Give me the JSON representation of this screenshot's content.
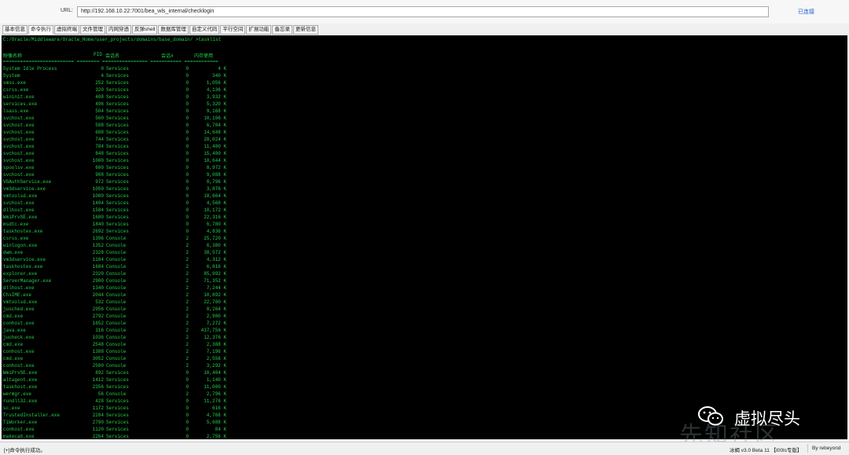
{
  "url_bar": {
    "label": "URL:",
    "value": "http://192.168.10.22:7001/bea_wls_internal/checklogin",
    "status": "已连接"
  },
  "tabs": [
    "基本信息",
    "命令执行",
    "虚拟终端",
    "文件管理",
    "内网穿透",
    "反弹shell",
    "数据库管理",
    "自定义代码",
    "平行空间",
    "扩展功能",
    "备忘录",
    "更新信息"
  ],
  "active_tab": 1,
  "terminal": {
    "prompt": "C:/Oracle/Middleware/Oracle_Home/user_projects/domains/base_domain/ >tasklist",
    "headers": {
      "name": "映像名称",
      "pid": "PID",
      "session_name": "会话名",
      "session_num": "会话#",
      "mem": "内存使用"
    },
    "separator": "========================= ======== ================ =========== ============",
    "processes": [
      [
        "System Idle Process",
        "0",
        "Services",
        "0",
        "4 K"
      ],
      [
        "System",
        "4",
        "Services",
        "0",
        "340 K"
      ],
      [
        "smss.exe",
        "252",
        "Services",
        "0",
        "1,056 K"
      ],
      [
        "csrss.exe",
        "320",
        "Services",
        "0",
        "4,136 K"
      ],
      [
        "wininit.exe",
        "408",
        "Services",
        "0",
        "3,932 K"
      ],
      [
        "services.exe",
        "496",
        "Services",
        "0",
        "5,320 K"
      ],
      [
        "lsass.exe",
        "504",
        "Services",
        "0",
        "9,168 K"
      ],
      [
        "svchost.exe",
        "560",
        "Services",
        "0",
        "10,196 K"
      ],
      [
        "svchost.exe",
        "588",
        "Services",
        "0",
        "6,704 K"
      ],
      [
        "svchost.exe",
        "688",
        "Services",
        "0",
        "14,648 K"
      ],
      [
        "svchost.exe",
        "744",
        "Services",
        "0",
        "28,024 K"
      ],
      [
        "svchost.exe",
        "784",
        "Services",
        "0",
        "11,400 K"
      ],
      [
        "svchost.exe",
        "848",
        "Services",
        "0",
        "15,400 K"
      ],
      [
        "svchost.exe",
        "1000",
        "Services",
        "0",
        "10,644 K"
      ],
      [
        "spoolsv.exe",
        "600",
        "Services",
        "0",
        "8,972 K"
      ],
      [
        "svchost.exe",
        "908",
        "Services",
        "0",
        "9,088 K"
      ],
      [
        "VGAuthService.exe",
        "972",
        "Services",
        "0",
        "8,796 K"
      ],
      [
        "vm3dservice.exe",
        "1050",
        "Services",
        "0",
        "3,876 K"
      ],
      [
        "vmtoolsd.exe",
        "1080",
        "Services",
        "0",
        "18,664 K"
      ],
      [
        "svchost.exe",
        "1404",
        "Services",
        "0",
        "4,568 K"
      ],
      [
        "dllhost.exe",
        "1584",
        "Services",
        "0",
        "10,172 K"
      ],
      [
        "WmiPrvSE.exe",
        "1680",
        "Services",
        "0",
        "22,316 K"
      ],
      [
        "msdtc.exe",
        "1840",
        "Services",
        "0",
        "6,780 K"
      ],
      [
        "taskhostex.exe",
        "2692",
        "Services",
        "0",
        "4,836 K"
      ],
      [
        "csrss.exe",
        "1396",
        "Console",
        "2",
        "25,720 K"
      ],
      [
        "winlogon.exe",
        "1352",
        "Console",
        "2",
        "6,380 K"
      ],
      [
        "dwm.exe",
        "2328",
        "Console",
        "2",
        "38,572 K"
      ],
      [
        "vm3dservice.exe",
        "1104",
        "Console",
        "2",
        "4,312 K"
      ],
      [
        "taskhostex.exe",
        "1684",
        "Console",
        "2",
        "6,816 K"
      ],
      [
        "explorer.exe",
        "2320",
        "Console",
        "2",
        "85,992 K"
      ],
      [
        "ServerManager.exe",
        "2900",
        "Console",
        "2",
        "71,352 K"
      ],
      [
        "dllhost.exe",
        "1340",
        "Console",
        "2",
        "7,244 K"
      ],
      [
        "ChsIME.exe",
        "2044",
        "Console",
        "2",
        "10,892 K"
      ],
      [
        "vmtoolsd.exe",
        "532",
        "Console",
        "2",
        "22,700 K"
      ],
      [
        "jusched.exe",
        "2956",
        "Console",
        "2",
        "8,264 K"
      ],
      [
        "cmd.exe",
        "2792",
        "Console",
        "2",
        "2,900 K"
      ],
      [
        "conhost.exe",
        "1652",
        "Console",
        "2",
        "7,272 K"
      ],
      [
        "java.exe",
        "316",
        "Console",
        "2",
        "437,756 K"
      ],
      [
        "jucheck.exe",
        "1036",
        "Console",
        "2",
        "12,376 K"
      ],
      [
        "cmd.exe",
        "2548",
        "Console",
        "2",
        "2,388 K"
      ],
      [
        "conhost.exe",
        "1388",
        "Console",
        "2",
        "7,196 K"
      ],
      [
        "cmd.exe",
        "3052",
        "Console",
        "2",
        "2,556 K"
      ],
      [
        "conhost.exe",
        "2500",
        "Console",
        "2",
        "3,292 K"
      ],
      [
        "WmiPrvSE.exe",
        "892",
        "Services",
        "0",
        "10,404 K"
      ],
      [
        "altagent.exe",
        "1412",
        "Services",
        "0",
        "1,140 K"
      ],
      [
        "taskhost.exe",
        "2356",
        "Services",
        "0",
        "11,000 K"
      ],
      [
        "wermgr.exe",
        "56",
        "Console",
        "2",
        "2,796 K"
      ],
      [
        "rundll32.exe",
        "428",
        "Services",
        "0",
        "11,276 K"
      ],
      [
        "sc.exe",
        "1172",
        "Services",
        "0",
        "616 K"
      ],
      [
        "TrustedInstaller.exe",
        "2204",
        "Services",
        "0",
        "4,768 K"
      ],
      [
        "TiWorker.exe",
        "2780",
        "Services",
        "0",
        "5,688 K"
      ],
      [
        "conhost.exe",
        "1120",
        "Services",
        "0",
        "84 K"
      ],
      [
        "makecab.exe",
        "2264",
        "Services",
        "0",
        "2,756 K"
      ]
    ]
  },
  "watermark": {
    "title": "虚拟尽头",
    "logo": "先知社区",
    "icon": "wechat-icon"
  },
  "status_bar": {
    "message": "[+]命令执行成功。",
    "version": "冰蝎 v3.0 Beta 11 【t00ls专版】",
    "author": "By rebeyond"
  },
  "colors": {
    "terminal_bg": "#000000",
    "terminal_fg": "#24d24a",
    "status_connected": "#1a5fd6"
  }
}
